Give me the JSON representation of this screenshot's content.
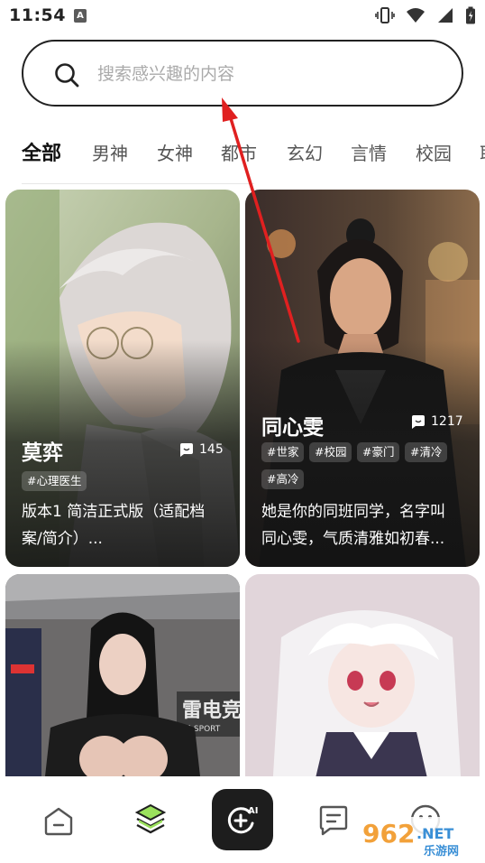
{
  "status_bar": {
    "time": "11:54",
    "app_icon_letter": "A",
    "icons": [
      "vibrate-icon",
      "wifi-icon",
      "signal-icon",
      "battery-icon"
    ]
  },
  "search": {
    "placeholder": "搜索感兴趣的内容"
  },
  "tabs": [
    {
      "label": "全部",
      "active": true
    },
    {
      "label": "男神",
      "active": false
    },
    {
      "label": "女神",
      "active": false
    },
    {
      "label": "都市",
      "active": false
    },
    {
      "label": "玄幻",
      "active": false
    },
    {
      "label": "言情",
      "active": false
    },
    {
      "label": "校园",
      "active": false
    },
    {
      "label": "耶",
      "active": false
    }
  ],
  "cards": [
    {
      "name": "莫弈",
      "count": "145",
      "tags": [
        "#心理医生"
      ],
      "description_lines": [
        "版本1 简洁正式版（适配档",
        "案/简介）..."
      ]
    },
    {
      "name": "同心雯",
      "count": "1217",
      "tags": [
        "#世家",
        "#校园",
        "#豪门",
        "#清冷",
        "#高冷"
      ],
      "description_lines": [
        "她是你的同班同学，名字叫",
        "同心雯，气质清雅如初春..."
      ]
    },
    {
      "name": "",
      "sign_text": "雷电竞",
      "sign_sub": "E-SPORT"
    },
    {
      "name": ""
    }
  ],
  "bottom_nav": {
    "items": [
      "home-icon",
      "discover-icon",
      "ai-create-icon",
      "message-icon",
      "profile-icon"
    ],
    "ai_badge": "AI",
    "accent": "#9be15d"
  },
  "watermark": {
    "number": "962",
    "suffix": ".NET",
    "label": "乐游网"
  }
}
